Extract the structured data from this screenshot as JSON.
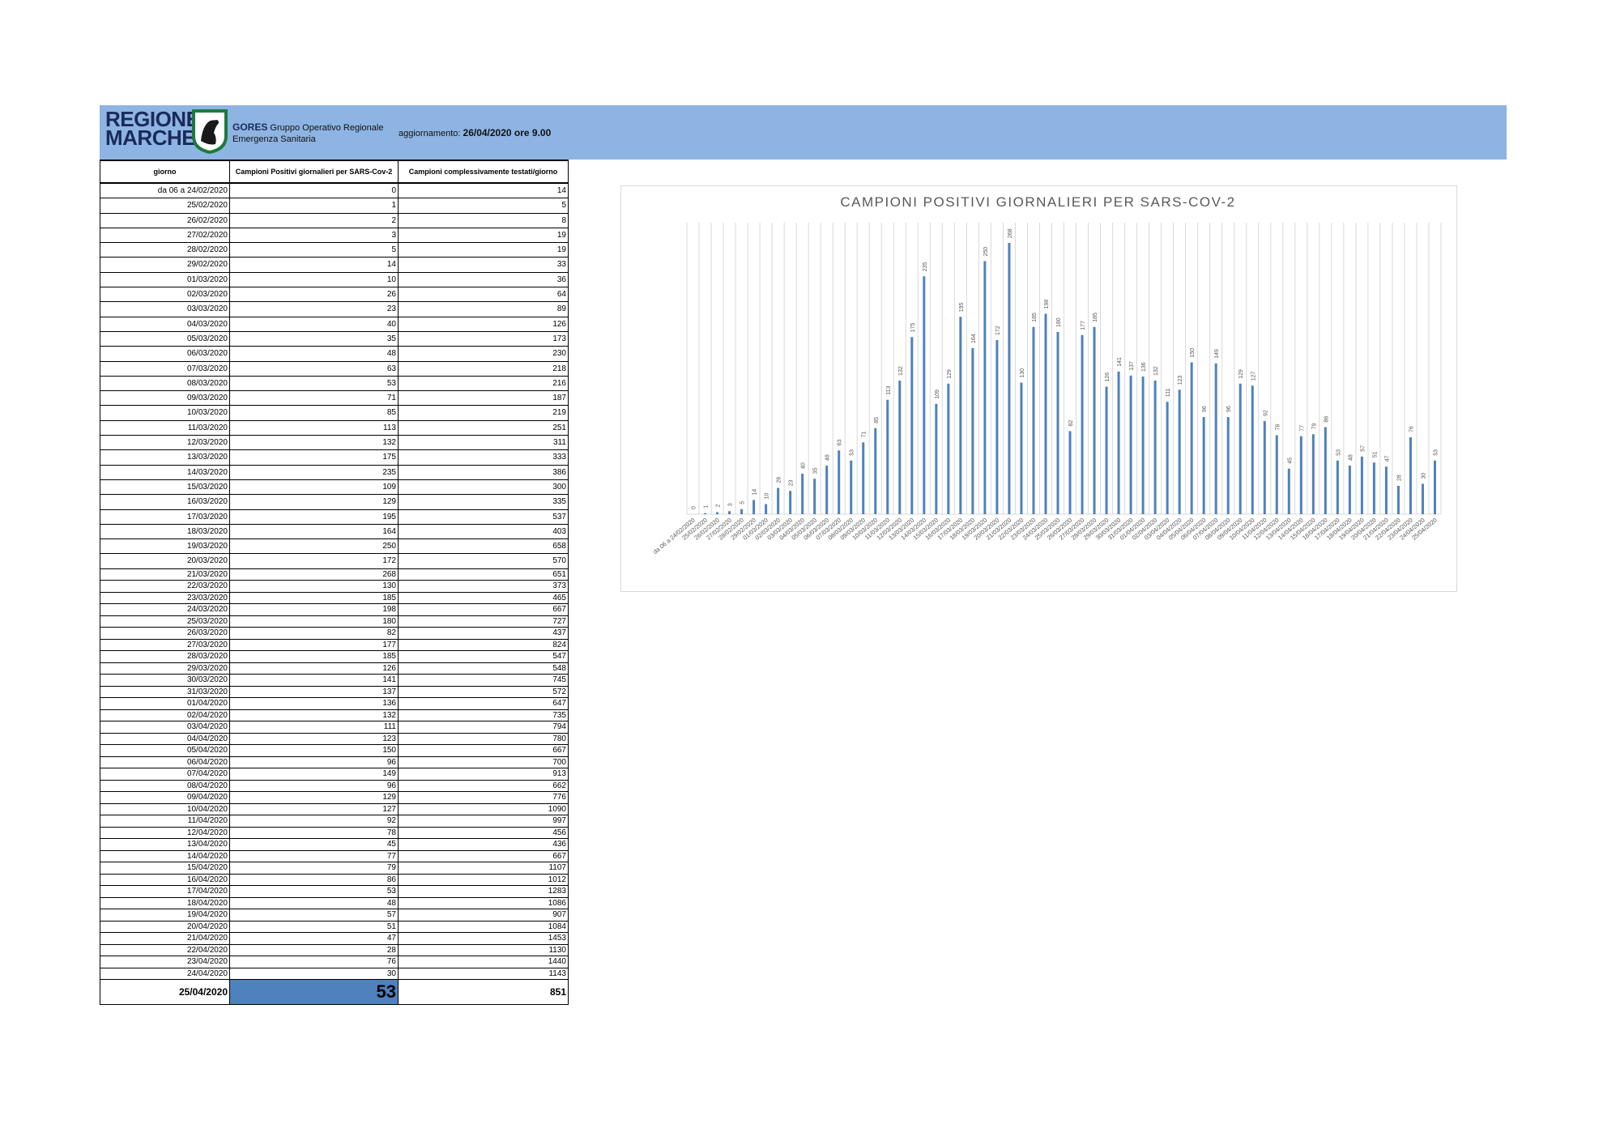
{
  "header": {
    "logo_line1": "REGIONE",
    "logo_line2": "MARCHE",
    "org_name": "GORES",
    "org_desc1": "Gruppo Operativo Regionale",
    "org_desc2": "Emergenza Sanitaria",
    "update_label": "aggiornamento:",
    "update_value": "26/04/2020 ore 9.00"
  },
  "table": {
    "headers": [
      "giorno",
      "Campioni Positivi giornalieri per SARS-Cov-2",
      "Campioni complessivamente testati/giorno"
    ],
    "rows": [
      [
        "da 06 a 24/02/2020",
        "0",
        "14"
      ],
      [
        "25/02/2020",
        "1",
        "5"
      ],
      [
        "26/02/2020",
        "2",
        "8"
      ],
      [
        "27/02/2020",
        "3",
        "19"
      ],
      [
        "28/02/2020",
        "5",
        "19"
      ],
      [
        "29/02/2020",
        "14",
        "33"
      ],
      [
        "01/03/2020",
        "10",
        "36"
      ],
      [
        "02/03/2020",
        "26",
        "64"
      ],
      [
        "03/03/2020",
        "23",
        "89"
      ],
      [
        "04/03/2020",
        "40",
        "126"
      ],
      [
        "05/03/2020",
        "35",
        "173"
      ],
      [
        "06/03/2020",
        "48",
        "230"
      ],
      [
        "07/03/2020",
        "63",
        "218"
      ],
      [
        "08/03/2020",
        "53",
        "216"
      ],
      [
        "09/03/2020",
        "71",
        "187"
      ],
      [
        "10/03/2020",
        "85",
        "219"
      ],
      [
        "11/03/2020",
        "113",
        "251"
      ],
      [
        "12/03/2020",
        "132",
        "311"
      ],
      [
        "13/03/2020",
        "175",
        "333"
      ],
      [
        "14/03/2020",
        "235",
        "386"
      ],
      [
        "15/03/2020",
        "109",
        "300"
      ],
      [
        "16/03/2020",
        "129",
        "335"
      ],
      [
        "17/03/2020",
        "195",
        "537"
      ],
      [
        "18/03/2020",
        "164",
        "403"
      ],
      [
        "19/03/2020",
        "250",
        "658"
      ],
      [
        "20/03/2020",
        "172",
        "570"
      ],
      [
        "21/03/2020",
        "268",
        "651"
      ],
      [
        "22/03/2020",
        "130",
        "373"
      ],
      [
        "23/03/2020",
        "185",
        "465"
      ],
      [
        "24/03/2020",
        "198",
        "667"
      ],
      [
        "25/03/2020",
        "180",
        "727"
      ],
      [
        "26/03/2020",
        "82",
        "437"
      ],
      [
        "27/03/2020",
        "177",
        "824"
      ],
      [
        "28/03/2020",
        "185",
        "547"
      ],
      [
        "29/03/2020",
        "126",
        "548"
      ],
      [
        "30/03/2020",
        "141",
        "745"
      ],
      [
        "31/03/2020",
        "137",
        "572"
      ],
      [
        "01/04/2020",
        "136",
        "647"
      ],
      [
        "02/04/2020",
        "132",
        "735"
      ],
      [
        "03/04/2020",
        "111",
        "794"
      ],
      [
        "04/04/2020",
        "123",
        "780"
      ],
      [
        "05/04/2020",
        "150",
        "667"
      ],
      [
        "06/04/2020",
        "96",
        "700"
      ],
      [
        "07/04/2020",
        "149",
        "913"
      ],
      [
        "08/04/2020",
        "96",
        "662"
      ],
      [
        "09/04/2020",
        "129",
        "776"
      ],
      [
        "10/04/2020",
        "127",
        "1090"
      ],
      [
        "11/04/2020",
        "92",
        "997"
      ],
      [
        "12/04/2020",
        "78",
        "456"
      ],
      [
        "13/04/2020",
        "45",
        "436"
      ],
      [
        "14/04/2020",
        "77",
        "667"
      ],
      [
        "15/04/2020",
        "79",
        "1107"
      ],
      [
        "16/04/2020",
        "86",
        "1012"
      ],
      [
        "17/04/2020",
        "53",
        "1283"
      ],
      [
        "18/04/2020",
        "48",
        "1086"
      ],
      [
        "19/04/2020",
        "57",
        "907"
      ],
      [
        "20/04/2020",
        "51",
        "1084"
      ],
      [
        "21/04/2020",
        "47",
        "1453"
      ],
      [
        "22/04/2020",
        "28",
        "1130"
      ],
      [
        "23/04/2020",
        "76",
        "1440"
      ],
      [
        "24/04/2020",
        "30",
        "1143"
      ]
    ],
    "last_row": [
      "25/04/2020",
      "53",
      "851"
    ]
  },
  "colors": {
    "banner": "#8eb4e3",
    "bar": "#4f81bd",
    "highlight_cell": "#4f81bd",
    "logo_text": "#1a2a5a",
    "shield": "#1e7a3c"
  },
  "chart_data": {
    "type": "bar",
    "title": "CAMPIONI POSITIVI GIORNALIERI PER SARS-COV-2",
    "xlabel": "",
    "ylabel": "",
    "grid": "vertical",
    "data_labels": true,
    "ylim": [
      0,
      280
    ],
    "categories": [
      "da 06 a 24/02/2020",
      "25/02/2020",
      "26/02/2020",
      "27/02/2020",
      "28/02/2020",
      "29/02/2020",
      "01/03/2020",
      "02/03/2020",
      "03/03/2020",
      "04/03/2020",
      "05/03/2020",
      "06/03/2020",
      "07/03/2020",
      "08/03/2020",
      "09/03/2020",
      "10/03/2020",
      "11/03/2020",
      "12/03/2020",
      "13/03/2020",
      "14/03/2020",
      "15/03/2020",
      "16/03/2020",
      "17/03/2020",
      "18/03/2020",
      "19/03/2020",
      "20/03/2020",
      "21/03/2020",
      "22/03/2020",
      "23/03/2020",
      "24/03/2020",
      "25/03/2020",
      "26/03/2020",
      "27/03/2020",
      "28/03/2020",
      "29/03/2020",
      "30/03/2020",
      "31/03/2020",
      "01/04/2020",
      "02/04/2020",
      "03/04/2020",
      "04/04/2020",
      "05/04/2020",
      "06/04/2020",
      "07/04/2020",
      "08/04/2020",
      "09/04/2020",
      "10/04/2020",
      "11/04/2020",
      "12/04/2020",
      "13/04/2020",
      "14/04/2020",
      "15/04/2020",
      "16/04/2020",
      "17/04/2020",
      "18/04/2020",
      "19/04/2020",
      "20/04/2020",
      "21/04/2020",
      "22/04/2020",
      "23/04/2020",
      "24/04/2020",
      "25/04/2020"
    ],
    "values": [
      0,
      1,
      2,
      3,
      5,
      14,
      10,
      26,
      23,
      40,
      35,
      48,
      63,
      53,
      71,
      85,
      113,
      132,
      175,
      235,
      109,
      129,
      195,
      164,
      250,
      172,
      268,
      130,
      185,
      198,
      180,
      82,
      177,
      185,
      126,
      141,
      137,
      136,
      132,
      111,
      123,
      150,
      96,
      149,
      96,
      129,
      127,
      92,
      78,
      45,
      77,
      79,
      86,
      53,
      48,
      57,
      51,
      47,
      28,
      76,
      30,
      53
    ]
  }
}
